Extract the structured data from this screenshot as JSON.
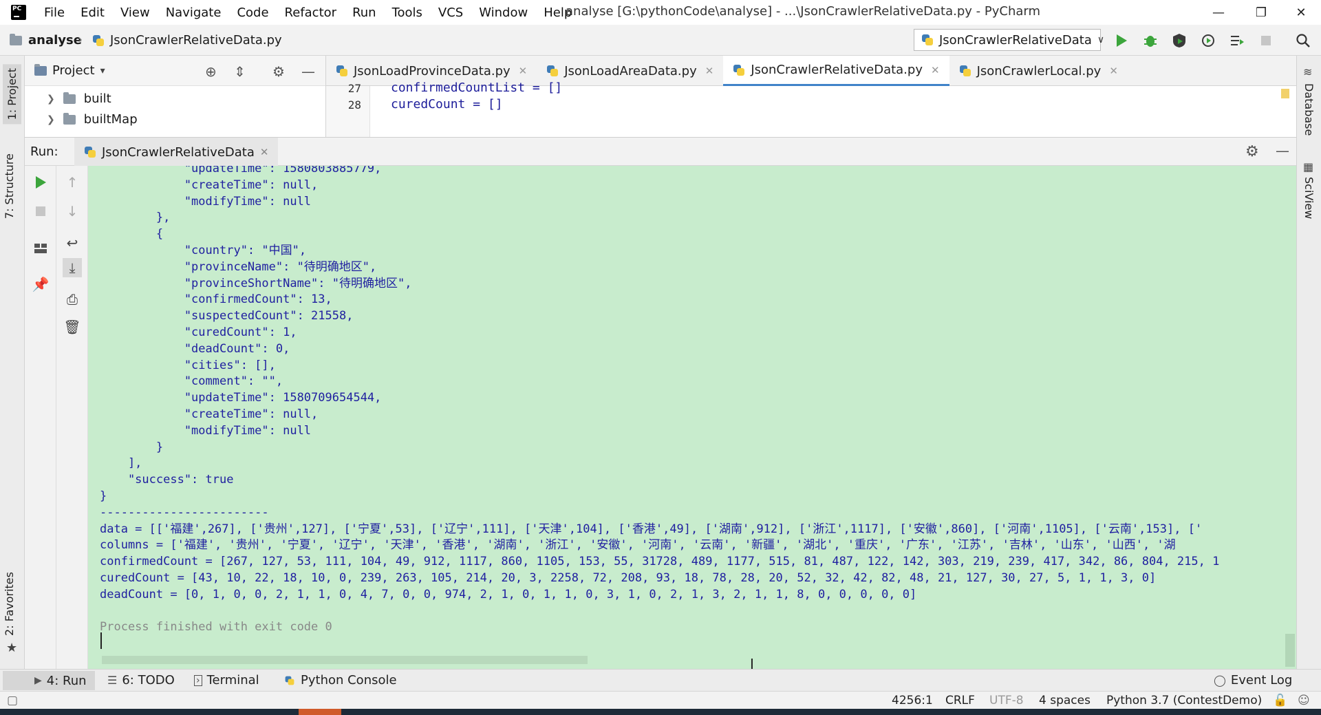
{
  "app": {
    "menu": [
      "File",
      "Edit",
      "View",
      "Navigate",
      "Code",
      "Refactor",
      "Run",
      "Tools",
      "VCS",
      "Window",
      "Help"
    ],
    "window_title": "analyse [G:\\pythonCode\\analyse] - ...\\JsonCrawlerRelativeData.py - PyCharm",
    "window_controls": [
      "—",
      "❐",
      "✕"
    ]
  },
  "navbar": {
    "project": "analyse",
    "separator": "›",
    "file": "JsonCrawlerRelativeData.py",
    "run_config": "JsonCrawlerRelativeData",
    "chevron": "∨",
    "colors": {
      "run": "#3ca53c",
      "debug": "#3ca53c",
      "stop": "#c6c6c6"
    }
  },
  "left_strip": {
    "project_tab": "1: Project",
    "structure_tab": "7: Structure",
    "favorites_tab": "2: Favorites"
  },
  "right_strip": {
    "database_tab": "Database",
    "sciview_tab": "SciView"
  },
  "project_panel": {
    "title": "Project",
    "chevron": "▾",
    "items": [
      {
        "label": "built",
        "arrow": "❯"
      },
      {
        "label": "builtMap",
        "arrow": "❯"
      }
    ]
  },
  "editor": {
    "tabs": [
      {
        "label": "JsonLoadProvinceData.py",
        "close": "✕"
      },
      {
        "label": "JsonLoadAreaData.py",
        "close": "✕"
      },
      {
        "label": "JsonCrawlerRelativeData.py",
        "close": "✕",
        "active": true
      },
      {
        "label": "JsonCrawlerLocal.py",
        "close": "✕"
      }
    ],
    "lines": [
      {
        "num": "27",
        "text": "confirmedCountList = []"
      },
      {
        "num": "28",
        "text": "curedCount = []"
      }
    ]
  },
  "run_panel": {
    "label": "Run:",
    "tab": "JsonCrawlerRelativeData",
    "tab_close": "✕",
    "console_lines": [
      "            \"updateTime\": 1580803885779,",
      "            \"createTime\": null,",
      "            \"modifyTime\": null",
      "        },",
      "        {",
      "            \"country\": \"中国\",",
      "            \"provinceName\": \"待明确地区\",",
      "            \"provinceShortName\": \"待明确地区\",",
      "            \"confirmedCount\": 13,",
      "            \"suspectedCount\": 21558,",
      "            \"curedCount\": 1,",
      "            \"deadCount\": 0,",
      "            \"cities\": [],",
      "            \"comment\": \"\",",
      "            \"updateTime\": 1580709654544,",
      "            \"createTime\": null,",
      "            \"modifyTime\": null",
      "        }",
      "    ],",
      "    \"success\": true",
      "}",
      "------------------------",
      "data = [['福建',267], ['贵州',127], ['宁夏',53], ['辽宁',111], ['天津',104], ['香港',49], ['湖南',912], ['浙江',1117], ['安徽',860], ['河南',1105], ['云南',153], ['",
      "columns = ['福建', '贵州', '宁夏', '辽宁', '天津', '香港', '湖南', '浙江', '安徽', '河南', '云南', '新疆', '湖北', '重庆', '广东', '江苏', '吉林', '山东', '山西', '湖",
      "confirmedCount = [267, 127, 53, 111, 104, 49, 912, 1117, 860, 1105, 153, 55, 31728, 489, 1177, 515, 81, 487, 122, 142, 303, 219, 239, 417, 342, 86, 804, 215, 1",
      "curedCount = [43, 10, 22, 18, 10, 0, 239, 263, 105, 214, 20, 3, 2258, 72, 208, 93, 18, 78, 28, 20, 52, 32, 42, 82, 48, 21, 127, 30, 27, 5, 1, 1, 3, 0]",
      "deadCount = [0, 1, 0, 0, 2, 1, 1, 0, 4, 7, 0, 0, 974, 2, 1, 0, 1, 1, 0, 3, 1, 0, 2, 1, 3, 2, 1, 1, 8, 0, 0, 0, 0, 0]",
      "",
      "Process finished with exit code 0"
    ]
  },
  "bottom_tools": {
    "run": "4: Run",
    "todo": "6: TODO",
    "terminal": "Terminal",
    "python_console": "Python Console",
    "event_log": "Event Log"
  },
  "status_bar": {
    "position": "4256:1",
    "line_sep": "CRLF",
    "encoding": "UTF-8",
    "indent": "4 spaces",
    "interpreter": "Python 3.7 (ContestDemo)"
  }
}
